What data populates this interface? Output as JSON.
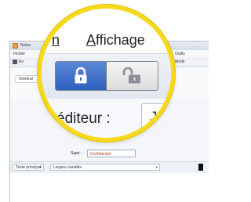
{
  "background_window": {
    "title": "Notes",
    "menu_file": "Fichier",
    "menu_options": "Outils",
    "toolbar_left": "En",
    "toolbar_right": "Mode",
    "tab_label": "Général",
    "subject_label": "Sujet :",
    "subject_value": "Confidentiel",
    "style_select": "Texte principal",
    "font_select": "Largeur variable"
  },
  "magnifier": {
    "menu_prev_visible": "n",
    "menu_affichage_first": "A",
    "menu_affichage_rest": "ffichage",
    "editor_label": "éditeur :",
    "editor_value": "Je",
    "lock_on_icon": "lock-closed-icon",
    "lock_off_icon": "lock-open-icon"
  },
  "colors": {
    "magnifier_ring": "#f6d81d",
    "lock_active": "#2d5fbf",
    "subject_text": "#c0392b"
  }
}
